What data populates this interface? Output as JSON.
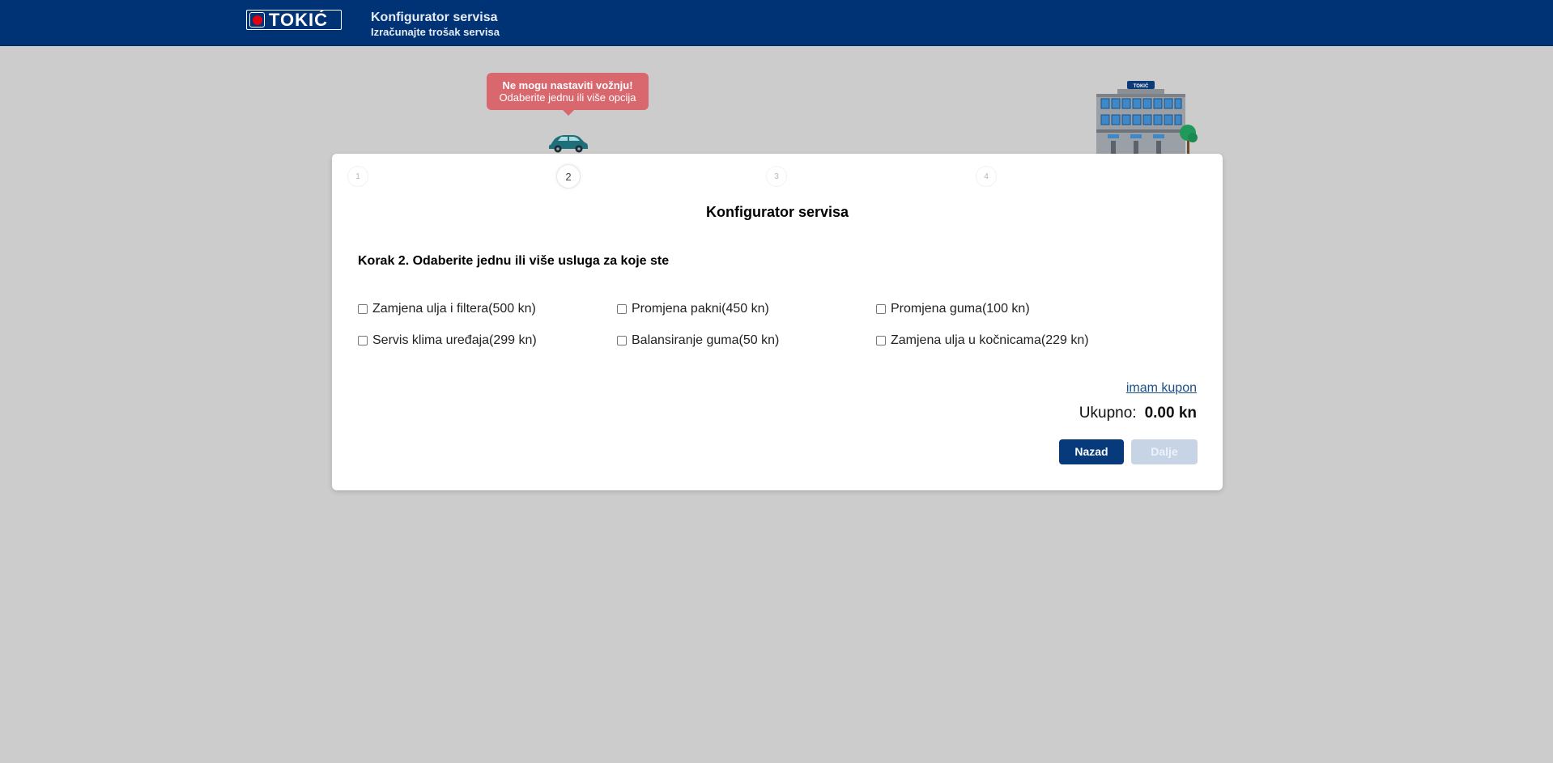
{
  "header": {
    "logo_text": "TOKIĆ",
    "title": "Konfigurator servisa",
    "subtitle": "Izračunajte trošak servisa"
  },
  "tooltip": {
    "title": "Ne mogu nastaviti vožnju!",
    "message": "Odaberite jednu ili više opcija"
  },
  "building_sign": "TOKIĆ",
  "steps": [
    "1",
    "2",
    "3",
    "4"
  ],
  "active_step": "2",
  "card": {
    "title": "Konfigurator servisa",
    "step_heading": "Korak 2. Odaberite jednu ili više usluga za koje ste"
  },
  "services": [
    {
      "label": "Zamjena ulja i filtera(500 kn)",
      "checked": false
    },
    {
      "label": "Promjena pakni(450 kn)",
      "checked": false
    },
    {
      "label": "Promjena guma(100 kn)",
      "checked": false
    },
    {
      "label": "Servis klima uređaja(299 kn)",
      "checked": false
    },
    {
      "label": "Balansiranje guma(50 kn)",
      "checked": false
    },
    {
      "label": "Zamjena ulja u kočnicama(229 kn)",
      "checked": false
    }
  ],
  "coupon_link": "imam kupon",
  "total": {
    "label": "Ukupno:",
    "value": "0.00 kn"
  },
  "buttons": {
    "back": "Nazad",
    "next": "Dalje"
  },
  "colors": {
    "header": "#003375",
    "tooltip": "#d9676e",
    "primary_button": "#063a7a",
    "disabled_button": "#c7d4e6",
    "background": "#cccccc",
    "car": "#1f6f7a"
  }
}
